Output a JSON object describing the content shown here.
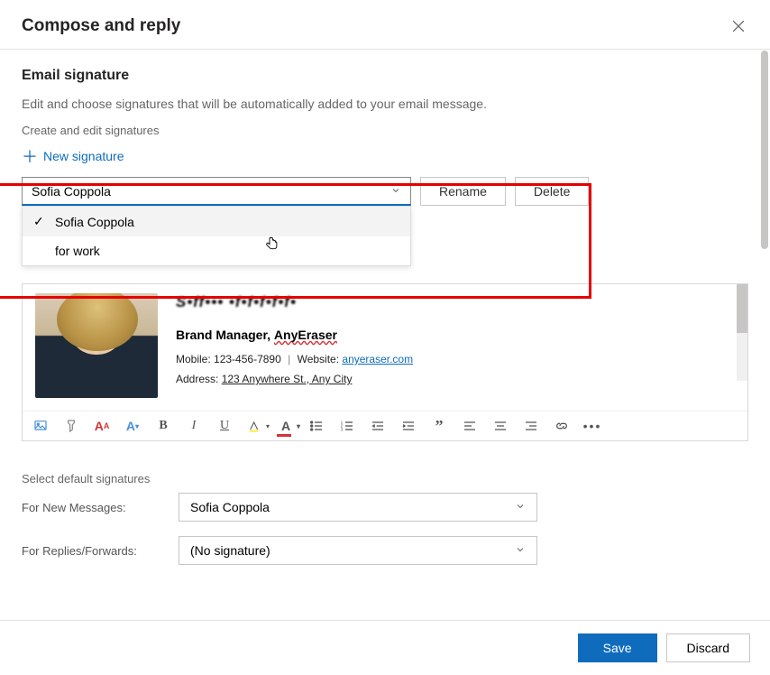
{
  "header": {
    "title": "Compose and reply"
  },
  "signature": {
    "section_title": "Email signature",
    "description": "Edit and choose signatures that will be automatically added to your email message.",
    "create_label": "Create and edit signatures",
    "new_label": "New signature",
    "selected": "Sofia Coppola",
    "rename": "Rename",
    "delete": "Delete",
    "options": [
      {
        "label": "Sofia Coppola",
        "selected": true
      },
      {
        "label": "for work",
        "selected": false
      }
    ]
  },
  "editor": {
    "name_preview": "S•ff••• •f•f•f•f•f•",
    "job_title": "Brand Manager,",
    "company": "AnyEraser",
    "mobile_label": "Mobile:",
    "mobile": "123-456-7890",
    "website_label": "Website:",
    "website": "anyeraser.com",
    "address_label": "Address:",
    "address": "123 Anywhere St., Any City"
  },
  "toolbar_icons": [
    "image",
    "paint",
    "font-size-up",
    "font-size-down",
    "bold",
    "italic",
    "underline",
    "highlight",
    "font-color",
    "bullets",
    "numbered",
    "outdent",
    "indent",
    "quote",
    "align-left",
    "align-center",
    "align-right",
    "link",
    "more"
  ],
  "defaults": {
    "section_title": "Select default signatures",
    "new_label": "For New Messages:",
    "new_value": "Sofia Coppola",
    "reply_label": "For Replies/Forwards:",
    "reply_value": "(No signature)"
  },
  "footer": {
    "save": "Save",
    "discard": "Discard"
  }
}
